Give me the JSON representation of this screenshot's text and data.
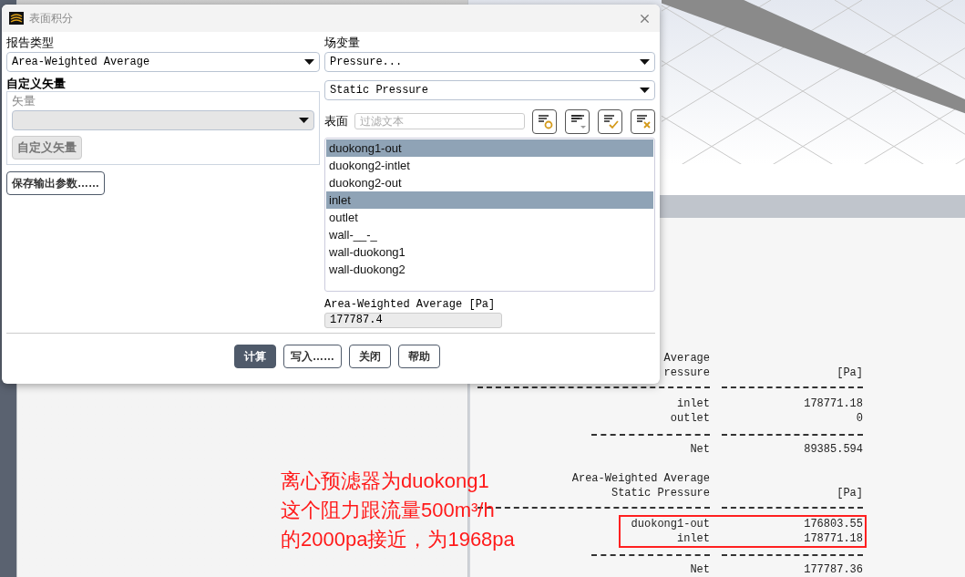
{
  "dialog": {
    "title": "表面积分",
    "report_type": {
      "label": "报告类型",
      "value": "Area-Weighted Average"
    },
    "custom_vector": {
      "heading": "自定义矢量",
      "label": "矢量",
      "button": "自定义矢量",
      "disabled": true
    },
    "save_button": "保存输出参数……",
    "field_variable": {
      "label": "场变量",
      "category": "Pressure...",
      "variable": "Static Pressure"
    },
    "surfaces": {
      "label": "表面",
      "placeholder": "过滤文本",
      "items": [
        {
          "name": "duokong1-out",
          "selected": true
        },
        {
          "name": "duokong2-intlet",
          "selected": false
        },
        {
          "name": "duokong2-out",
          "selected": false
        },
        {
          "name": "inlet",
          "selected": true
        },
        {
          "name": "outlet",
          "selected": false
        },
        {
          "name": "wall-__-_",
          "selected": false
        },
        {
          "name": "wall-duokong1",
          "selected": false
        },
        {
          "name": "wall-duokong2",
          "selected": false
        }
      ]
    },
    "result": {
      "label": "Area-Weighted Average [Pa]",
      "value": "177787.4"
    },
    "buttons": [
      {
        "label": "计算",
        "primary": true
      },
      {
        "label": "写入……",
        "primary": false
      },
      {
        "label": "关闭",
        "primary": false
      },
      {
        "label": "帮助",
        "primary": false
      }
    ]
  },
  "console": {
    "blocks": [
      {
        "title_lines": [
          "Average",
          "ressure"
        ],
        "unit": "[Pa]",
        "boxed": false,
        "rows": [
          {
            "name": "inlet",
            "value": "178771.18"
          },
          {
            "name": "outlet",
            "value": "0"
          }
        ],
        "net": {
          "label": "Net",
          "value": "89385.594"
        }
      },
      {
        "title_lines": [
          "Area-Weighted Average",
          "Static Pressure"
        ],
        "unit": "[Pa]",
        "boxed": true,
        "rows": [
          {
            "name": "duokong1-out",
            "value": "176803.55"
          },
          {
            "name": "inlet",
            "value": "178771.18"
          }
        ],
        "net": {
          "label": "Net",
          "value": "177787.36"
        }
      }
    ]
  },
  "annotation": {
    "lines": [
      "离心预滤器为duokong1",
      "这个阻力跟流量500m³/h",
      "的2000pa接近，为1968pa"
    ]
  }
}
